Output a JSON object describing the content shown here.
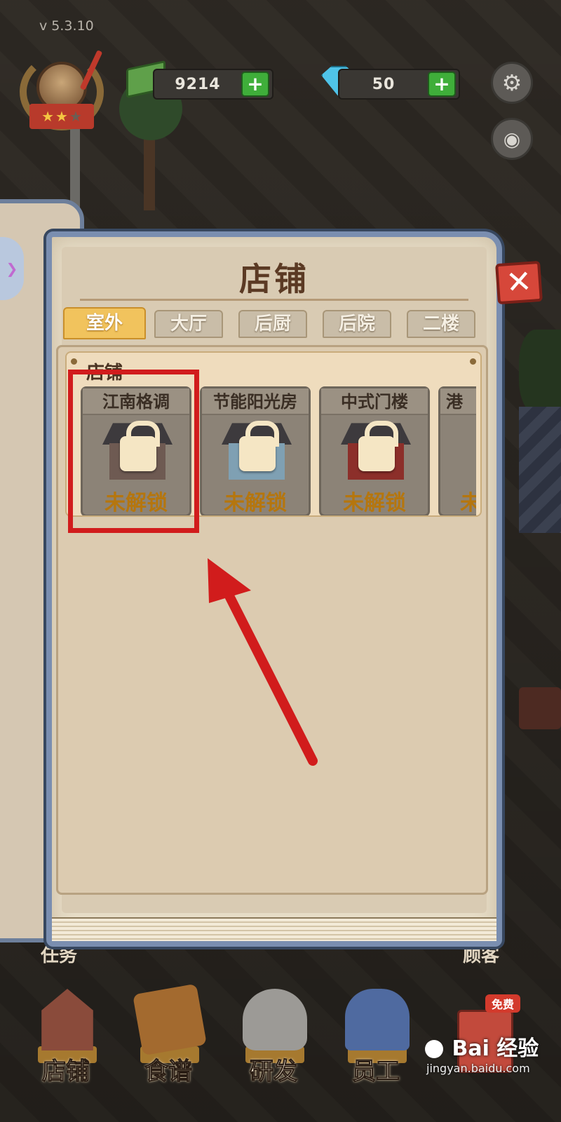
{
  "version": "v  5.3.10",
  "hud": {
    "cash": "9214",
    "gems": "50",
    "plus_label": "+",
    "stars_filled": 2,
    "stars_total": 3,
    "settings_icon": "gear-icon",
    "camera_icon": "camera-icon"
  },
  "modal": {
    "title": "店铺",
    "close_label": "✕",
    "tabs": [
      {
        "label": "室外",
        "active": true
      },
      {
        "label": "大厅",
        "active": false
      },
      {
        "label": "后厨",
        "active": false
      },
      {
        "label": "后院",
        "active": false
      },
      {
        "label": "二楼",
        "active": false
      }
    ],
    "section_title": "店铺",
    "items": [
      {
        "name": "江南格调",
        "status": "未解锁"
      },
      {
        "name": "节能阳光房",
        "status": "未解锁"
      },
      {
        "name": "中式门楼",
        "status": "未解锁"
      },
      {
        "name": "港",
        "status": "未"
      }
    ]
  },
  "bottom_nav": [
    {
      "label": "店铺"
    },
    {
      "label": "食谱"
    },
    {
      "label": "研发"
    },
    {
      "label": "员工"
    }
  ],
  "free_badge": "免费",
  "side_labels": {
    "left": "任务",
    "right": "顾客"
  },
  "watermark": {
    "brand": "Bai  经验",
    "url": "jingyan.baidu.com"
  },
  "colors": {
    "highlight": "#d11c1c",
    "tab_active": "#f1c35d",
    "locked_text": "#b5760e"
  }
}
